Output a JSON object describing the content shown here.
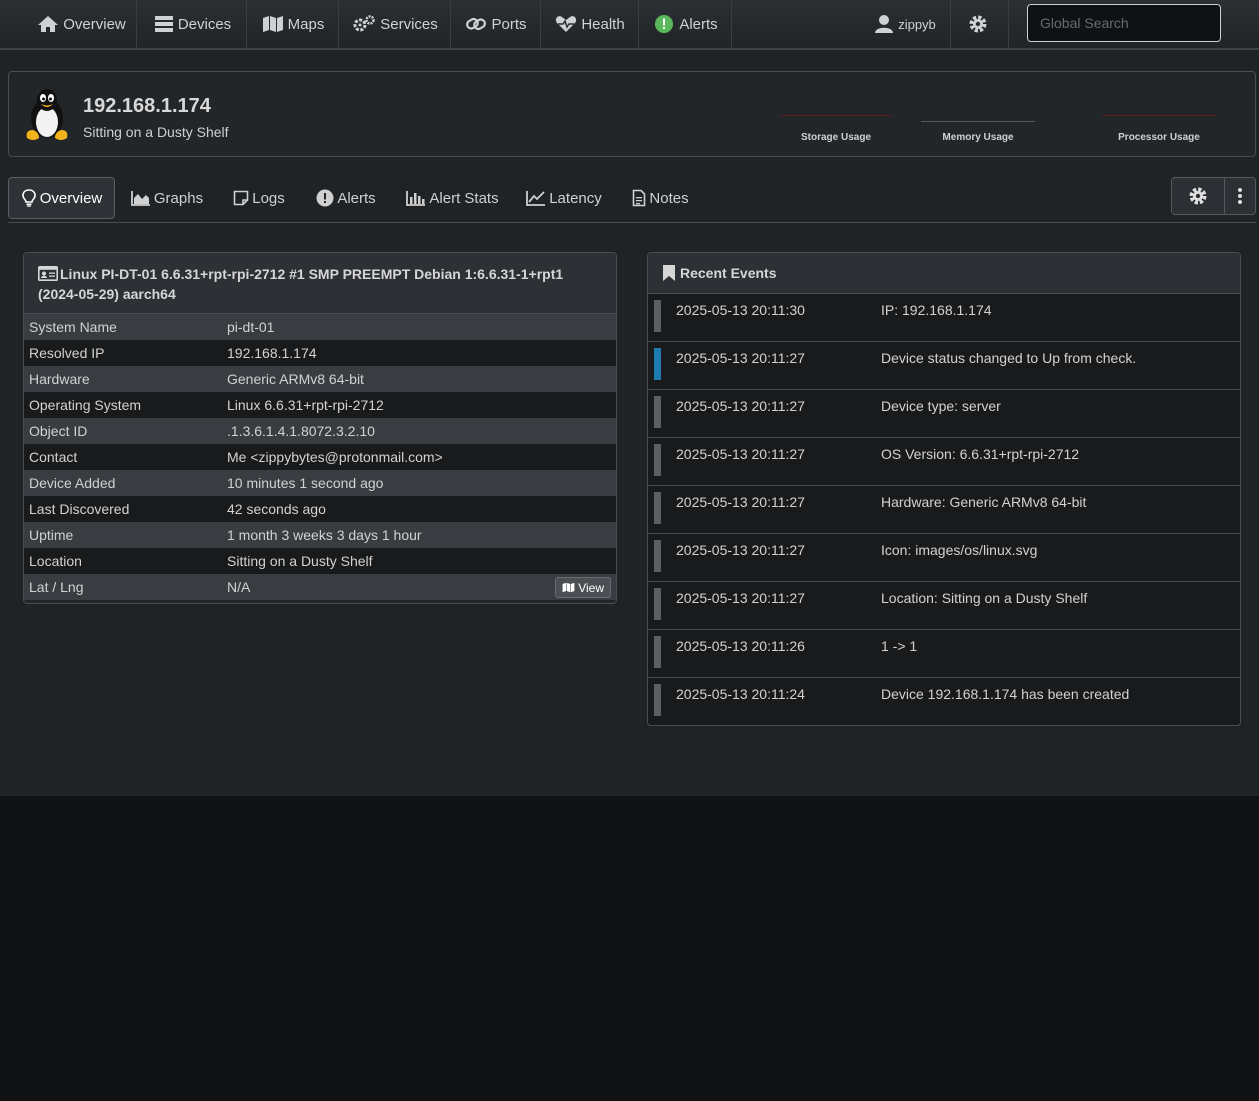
{
  "nav": {
    "items": [
      {
        "label": "Overview",
        "icon": "home-icon"
      },
      {
        "label": "Devices",
        "icon": "server-icon"
      },
      {
        "label": "Maps",
        "icon": "map-icon"
      },
      {
        "label": "Services",
        "icon": "cogs-icon"
      },
      {
        "label": "Ports",
        "icon": "link-icon"
      },
      {
        "label": "Health",
        "icon": "heartbeat-icon"
      },
      {
        "label": "Alerts",
        "icon": "alert-circle-icon"
      }
    ],
    "user": "zippyb",
    "search_placeholder": "Global Search",
    "alert_color": "#5cb85c"
  },
  "device": {
    "ip": "192.168.1.174",
    "location": "Sitting on a Dusty Shelf",
    "os_icon": "linux-penguin-icon",
    "usage": {
      "storage": "Storage Usage",
      "memory": "Memory Usage",
      "processor": "Processor Usage"
    }
  },
  "tabs": [
    {
      "label": "Overview",
      "icon": "lightbulb-icon",
      "active": true
    },
    {
      "label": "Graphs",
      "icon": "area-chart-icon"
    },
    {
      "label": "Logs",
      "icon": "sticky-note-icon"
    },
    {
      "label": "Alerts",
      "icon": "exclamation-circle-icon"
    },
    {
      "label": "Alert Stats",
      "icon": "bar-chart-icon"
    },
    {
      "label": "Latency",
      "icon": "line-chart-icon"
    },
    {
      "label": "Notes",
      "icon": "file-text-icon"
    }
  ],
  "overview": {
    "title": "Linux PI-DT-01 6.6.31+rpt-rpi-2712 #1 SMP PREEMPT Debian 1:6.6.31-1+rpt1 (2024-05-29) aarch64",
    "rows": [
      {
        "k": "System Name",
        "v": "pi-dt-01"
      },
      {
        "k": "Resolved IP",
        "v": "192.168.1.174"
      },
      {
        "k": "Hardware",
        "v": "Generic ARMv8 64-bit"
      },
      {
        "k": "Operating System",
        "v": "Linux 6.6.31+rpt-rpi-2712"
      },
      {
        "k": "Object ID",
        "v": ".1.3.6.1.4.1.8072.3.2.10"
      },
      {
        "k": "Contact",
        "v": "Me <zippybytes@protonmail.com>"
      },
      {
        "k": "Device Added",
        "v": "10 minutes 1 second ago"
      },
      {
        "k": "Last Discovered",
        "v": "42 seconds ago"
      },
      {
        "k": "Uptime",
        "v": "1 month 3 weeks 3 days 1 hour"
      },
      {
        "k": "Location",
        "v": "Sitting on a Dusty Shelf"
      },
      {
        "k": "Lat / Lng",
        "v": "N/A"
      }
    ],
    "view_label": "View"
  },
  "events": {
    "title": "Recent Events",
    "rows": [
      {
        "time": "2025-05-13 20:11:30",
        "msg": "IP: 192.168.1.174",
        "severity": "none"
      },
      {
        "time": "2025-05-13 20:11:27",
        "msg": "Device status changed to Up from check.",
        "severity": "info"
      },
      {
        "time": "2025-05-13 20:11:27",
        "msg": "Device type: server",
        "severity": "none"
      },
      {
        "time": "2025-05-13 20:11:27",
        "msg": "OS Version: 6.6.31+rpt-rpi-2712",
        "severity": "none"
      },
      {
        "time": "2025-05-13 20:11:27",
        "msg": "Hardware: Generic ARMv8 64-bit",
        "severity": "none"
      },
      {
        "time": "2025-05-13 20:11:27",
        "msg": "Icon: images/os/linux.svg",
        "severity": "none"
      },
      {
        "time": "2025-05-13 20:11:27",
        "msg": "Location: Sitting on a Dusty Shelf",
        "severity": "none"
      },
      {
        "time": "2025-05-13 20:11:26",
        "msg": "1 -> 1",
        "severity": "none"
      },
      {
        "time": "2025-05-13 20:11:24",
        "msg": "Device 192.168.1.174 has been created",
        "severity": "none"
      }
    ],
    "severity_colors": {
      "none": "#5b5f63",
      "info": "#1c7bb0"
    }
  }
}
